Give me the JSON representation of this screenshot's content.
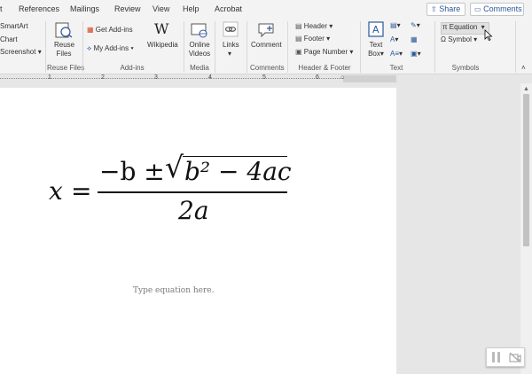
{
  "tabs": [
    "t",
    "References",
    "Mailings",
    "Review",
    "View",
    "Help",
    "Acrobat"
  ],
  "topbar": {
    "share_label": "Share",
    "comments_label": "Comments"
  },
  "ribbon": {
    "illustrations": {
      "smartart": "SmartArt",
      "chart": "Chart",
      "screenshot": "Screenshot"
    },
    "reuse_files": {
      "label_line1": "Reuse",
      "label_line2": "Files",
      "group": "Reuse Files"
    },
    "addins": {
      "get_addins": "Get Add-ins",
      "my_addins": "My Add-ins",
      "wikipedia": "Wikipedia",
      "group": "Add-ins"
    },
    "media": {
      "label_line1": "Online",
      "label_line2": "Videos",
      "group": "Media"
    },
    "links": {
      "label": "Links"
    },
    "comments": {
      "label": "Comment",
      "group": "Comments"
    },
    "header_footer": {
      "header": "Header",
      "footer": "Footer",
      "page_number": "Page Number",
      "group": "Header & Footer"
    },
    "text": {
      "text_box_line1": "Text",
      "text_box_line2": "Box",
      "group": "Text"
    },
    "symbols": {
      "equation": "Equation",
      "symbol": "Symbol",
      "group": "Symbols"
    }
  },
  "ruler": {
    "ticks": [
      "1",
      "2",
      "3",
      "4",
      "5",
      "6"
    ]
  },
  "document": {
    "equation": {
      "lhs": "x",
      "equals": "=",
      "numerator_start": "−b ±",
      "radicand": "b² − 4ac",
      "denominator": "2a"
    },
    "placeholder": "Type equation here."
  },
  "colors": {
    "accent": "#2b579a",
    "ribbon_bg": "#f3f3f3",
    "page_bg": "#ffffff"
  }
}
